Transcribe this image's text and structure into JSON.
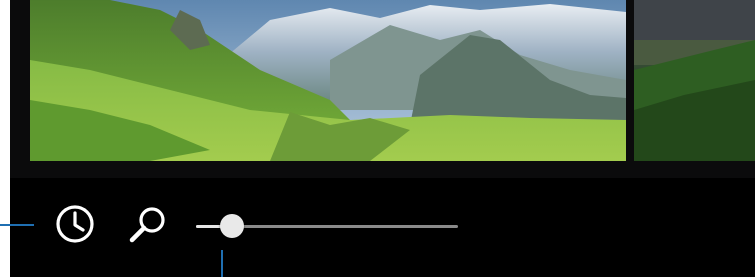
{
  "icons": {
    "history": "clock-icon",
    "search": "magnifier-icon"
  },
  "zoom": {
    "level": 0.1
  },
  "colors": {
    "toolbar_bg": "#000000",
    "icon": "#ffffff",
    "slider_track": "#8a8a8a",
    "slider_thumb": "#e9e9e9",
    "callout": "#1f6fb2"
  }
}
